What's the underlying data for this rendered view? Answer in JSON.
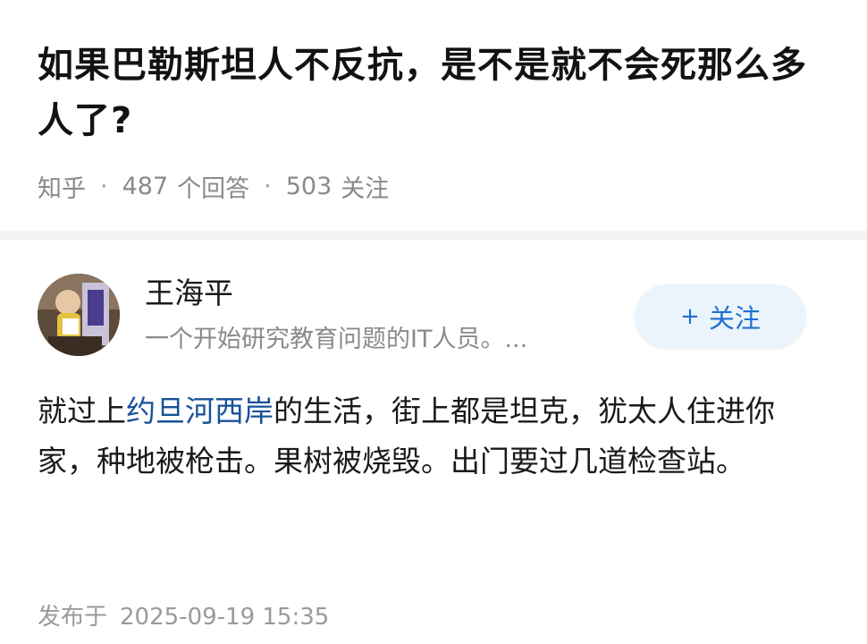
{
  "question": {
    "title": "如果巴勒斯坦人不反抗，是不是就不会死那么多人了?",
    "source": "知乎",
    "answers_count": "487",
    "answers_label": "个回答",
    "followers_count": "503",
    "followers_label": "关注"
  },
  "answer": {
    "author": {
      "name": "王海平",
      "bio": "一个开始研究教育问题的IT人员。...",
      "avatar_icon": "avatar-photo"
    },
    "follow_button": {
      "plus": "+",
      "label": "关注"
    },
    "body": {
      "before_link": "就过上",
      "link_text": "约旦河西岸",
      "after_link": "的生活，街上都是坦克，犹太人住进你家，种地被枪击。果树被烧毁。出门要过几道检查站。"
    },
    "publish": {
      "label": "发布于",
      "time": "2025-09-19 15:35"
    }
  },
  "colors": {
    "link": "#175199",
    "accent": "#1f6fd1",
    "follow_bg": "#ebf4fb",
    "meta_text": "#8a8a8a",
    "divider": "#f2f3f5"
  }
}
